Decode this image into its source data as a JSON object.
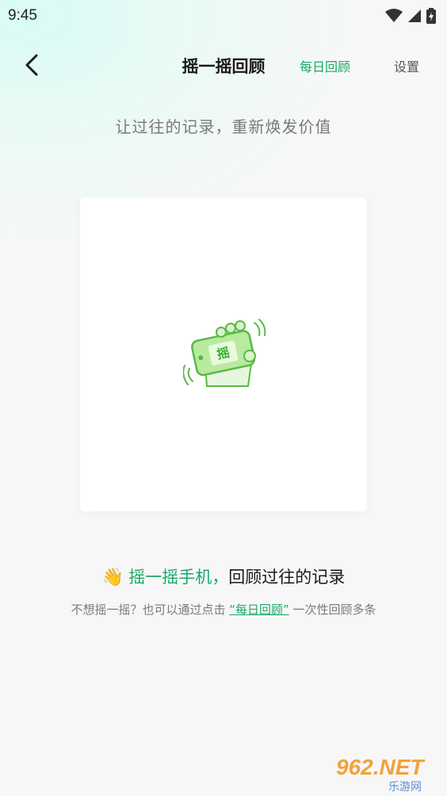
{
  "status_bar": {
    "time": "9:45"
  },
  "nav": {
    "title": "摇一摇回顾",
    "daily_review": "每日回顾",
    "settings": "设置"
  },
  "subtitle": "让过往的记录，重新焕发价值",
  "card": {
    "badge_text": "摇"
  },
  "prompt": {
    "hand_emoji": "👋",
    "accent": "摇一摇手机，",
    "rest": "回顾过往的记录"
  },
  "hint": {
    "before": "不想摇一摇？也可以通过点击 ",
    "link": "“每日回顾”",
    "after": " 一次性回顾多条"
  },
  "watermark": {
    "top": "962.NET",
    "bottom": "乐游网"
  },
  "colors": {
    "accent": "#1aa868",
    "background": "#f7f7f8"
  }
}
